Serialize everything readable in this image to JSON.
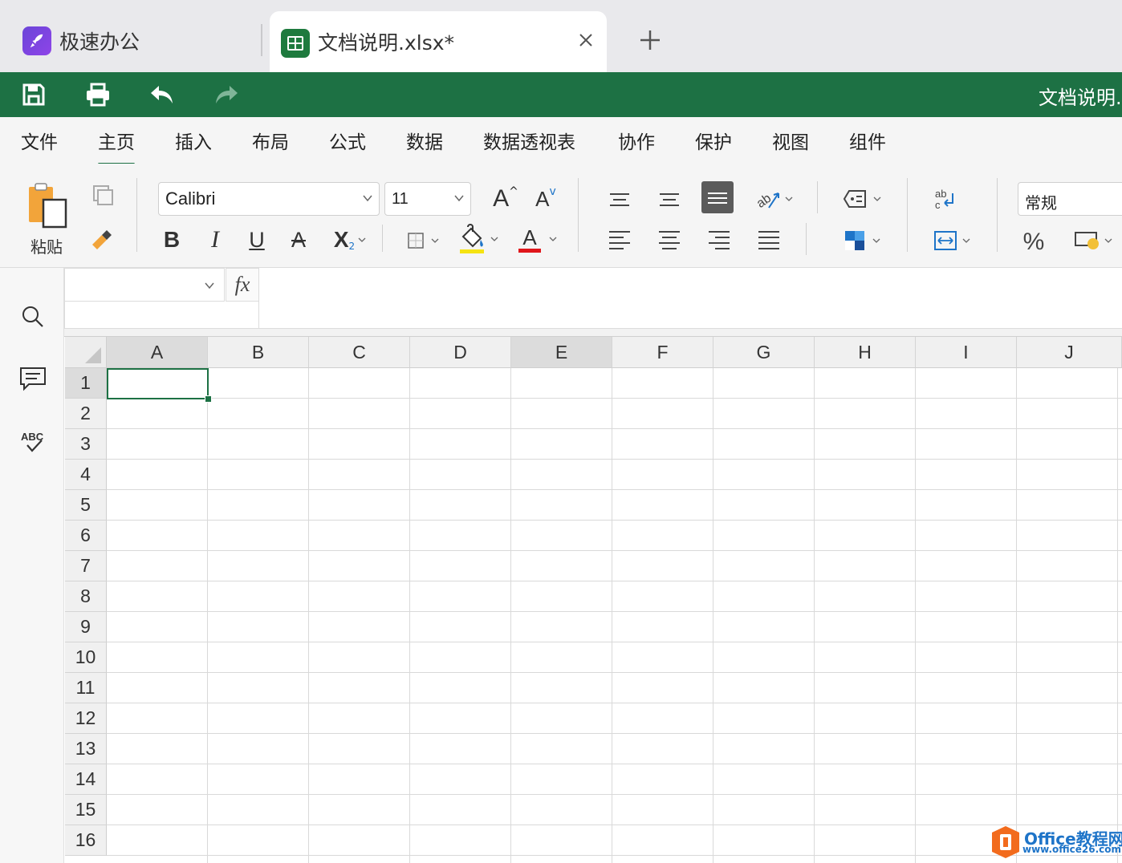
{
  "tabs": {
    "home_label": "极速办公",
    "doc_label": "文档说明.xlsx*"
  },
  "titlebar": {
    "doc_title": "文档说明."
  },
  "menu": {
    "items": [
      "文件",
      "主页",
      "插入",
      "布局",
      "公式",
      "数据",
      "数据透视表",
      "协作",
      "保护",
      "视图",
      "组件"
    ],
    "active": "主页"
  },
  "ribbon": {
    "paste_label": "粘贴",
    "font_name": "Calibri",
    "font_size": "11",
    "number_format": "常规",
    "bold": "B",
    "italic": "I",
    "underline": "U",
    "strike": "A",
    "subscript": "X",
    "grow": "A",
    "shrink": "A",
    "font_color": "A",
    "percent": "%"
  },
  "formula_bar": {
    "fx_label": "fx",
    "name_box_value": "",
    "formula_value": ""
  },
  "grid": {
    "columns": [
      "A",
      "B",
      "C",
      "D",
      "E",
      "F",
      "G",
      "H",
      "I",
      "J"
    ],
    "rows": [
      "1",
      "2",
      "3",
      "4",
      "5",
      "6",
      "7",
      "8",
      "9",
      "10",
      "11",
      "12",
      "13",
      "14",
      "15",
      "16"
    ],
    "selected_columns": [
      "A",
      "E"
    ],
    "selected_row": "1",
    "active_cell": "A1"
  },
  "watermark": {
    "title": "Office教程网",
    "url": "www.office26.com"
  },
  "colors": {
    "brand_green": "#1d7144",
    "app_purple": "#7b4be0",
    "watermark_blue": "#1e74c8",
    "watermark_orange": "#f26b1d"
  }
}
